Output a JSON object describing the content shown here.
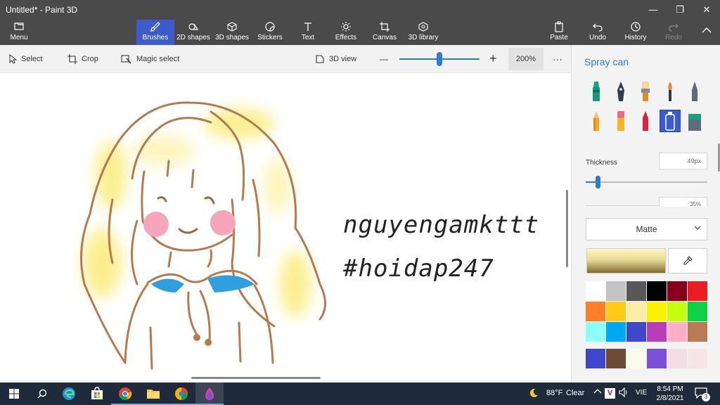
{
  "window": {
    "title": "Untitled* - Paint 3D",
    "minimize": "—",
    "maximize": "❐",
    "close": "✕"
  },
  "ribbon": {
    "menu": "Menu",
    "tools": [
      {
        "label": "Brushes",
        "icon": "brush-icon",
        "active": true
      },
      {
        "label": "2D shapes",
        "icon": "2d-shapes-icon"
      },
      {
        "label": "3D shapes",
        "icon": "3d-shapes-icon"
      },
      {
        "label": "Stickers",
        "icon": "stickers-icon"
      },
      {
        "label": "Text",
        "icon": "text-icon"
      },
      {
        "label": "Effects",
        "icon": "effects-icon"
      },
      {
        "label": "Canvas",
        "icon": "canvas-icon"
      },
      {
        "label": "3D library",
        "icon": "3d-library-icon"
      }
    ],
    "paste": "Paste",
    "undo": "Undo",
    "history": "History",
    "redo": "Redo"
  },
  "toolbar": {
    "select": "Select",
    "crop": "Crop",
    "magic_select": "Magic select",
    "view_3d": "3D view",
    "zoom_minus": "—",
    "zoom_plus": "+",
    "zoom_level": "200%",
    "zoom_fraction": 0.5,
    "more": "···"
  },
  "canvas": {
    "line1": "nguyengamkttt",
    "line2": "#hoidap247"
  },
  "panel": {
    "title": "Spray can",
    "brushes": [
      {
        "name": "marker"
      },
      {
        "name": "calligraphy-pen"
      },
      {
        "name": "oil-brush"
      },
      {
        "name": "watercolor"
      },
      {
        "name": "pixel-pen"
      },
      {
        "name": "pencil"
      },
      {
        "name": "eraser"
      },
      {
        "name": "crayon"
      },
      {
        "name": "spray-can",
        "selected": true
      },
      {
        "name": "fill"
      }
    ],
    "thickness_label": "Thickness",
    "thickness_value": "49px",
    "opacity_value": "35%",
    "thickness_fraction": 0.1,
    "finish": "Matte",
    "palette": [
      "#ffffff",
      "#c3c3c3",
      "#585858",
      "#000000",
      "#88001b",
      "#ec1c24",
      "#ff7f27",
      "#ffca18",
      "#fdeca6",
      "#fff200",
      "#c4ff0e",
      "#0ed145",
      "#8cfffb",
      "#00a8f3",
      "#3f48cc",
      "#b83dba",
      "#ffaec8",
      "#b97a56"
    ],
    "custom_colors": [
      "#3f48cc",
      "#6b4a36",
      "#fdfbf0",
      "#7b4fd8",
      "#f1dde4",
      "#f4e6e8"
    ]
  },
  "taskbar": {
    "apps": [
      "windows-start",
      "search",
      "edge",
      "store",
      "chrome",
      "file-explorer",
      "paint-app",
      "paint-3d"
    ],
    "weather_temp": "88°F",
    "weather_desc": "Clear",
    "lang": "VIE",
    "time": "8:54 PM",
    "date": "2/8/2021",
    "notif_count": "3"
  }
}
